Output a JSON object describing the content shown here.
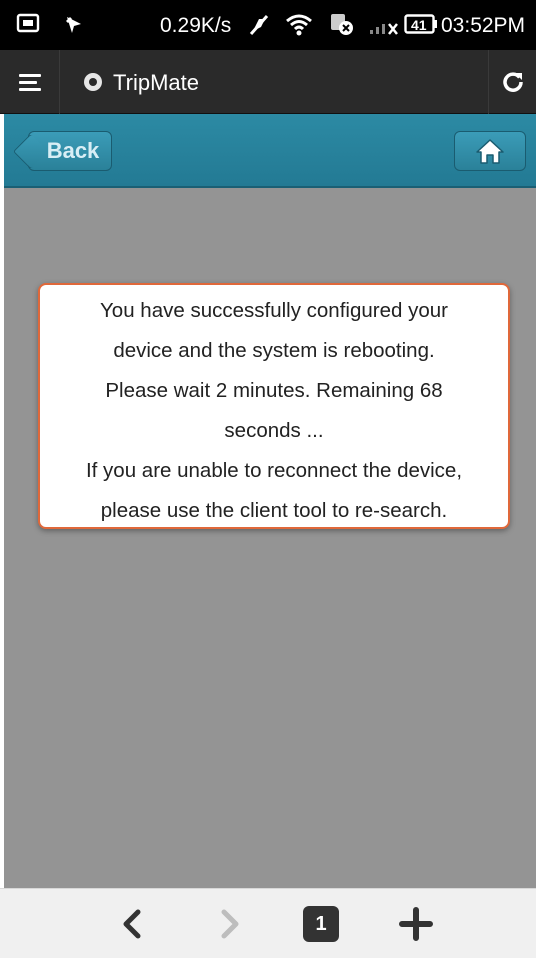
{
  "status_bar": {
    "speed": "0.29K/s",
    "battery": "41",
    "time": "03:52PM",
    "icons": [
      "screenshot-icon",
      "notification-icon",
      "mute-icon",
      "wifi-icon",
      "sync-off-icon",
      "signal-icon",
      "battery-icon"
    ]
  },
  "browser": {
    "site_title": "TripMate",
    "icons": [
      "menu-icon",
      "site-favicon-icon",
      "reload-icon"
    ]
  },
  "header": {
    "back_label": "Back",
    "home_icon": "home-icon"
  },
  "dialog": {
    "lines": [
      "You have successfully configured your",
      "device and the system is rebooting.",
      "Please wait 2 minutes. Remaining 68",
      "seconds ...",
      "If you are unable to reconnect the device,",
      "please use the client tool to re-search."
    ]
  },
  "bottom_nav": {
    "tab_count": "1",
    "icons": [
      "back-arrow-icon",
      "forward-arrow-icon",
      "tabs-icon",
      "new-tab-icon"
    ]
  },
  "colors": {
    "header_teal": "#2a8199",
    "dialog_border": "#e0683a",
    "content_gray": "#949494"
  }
}
